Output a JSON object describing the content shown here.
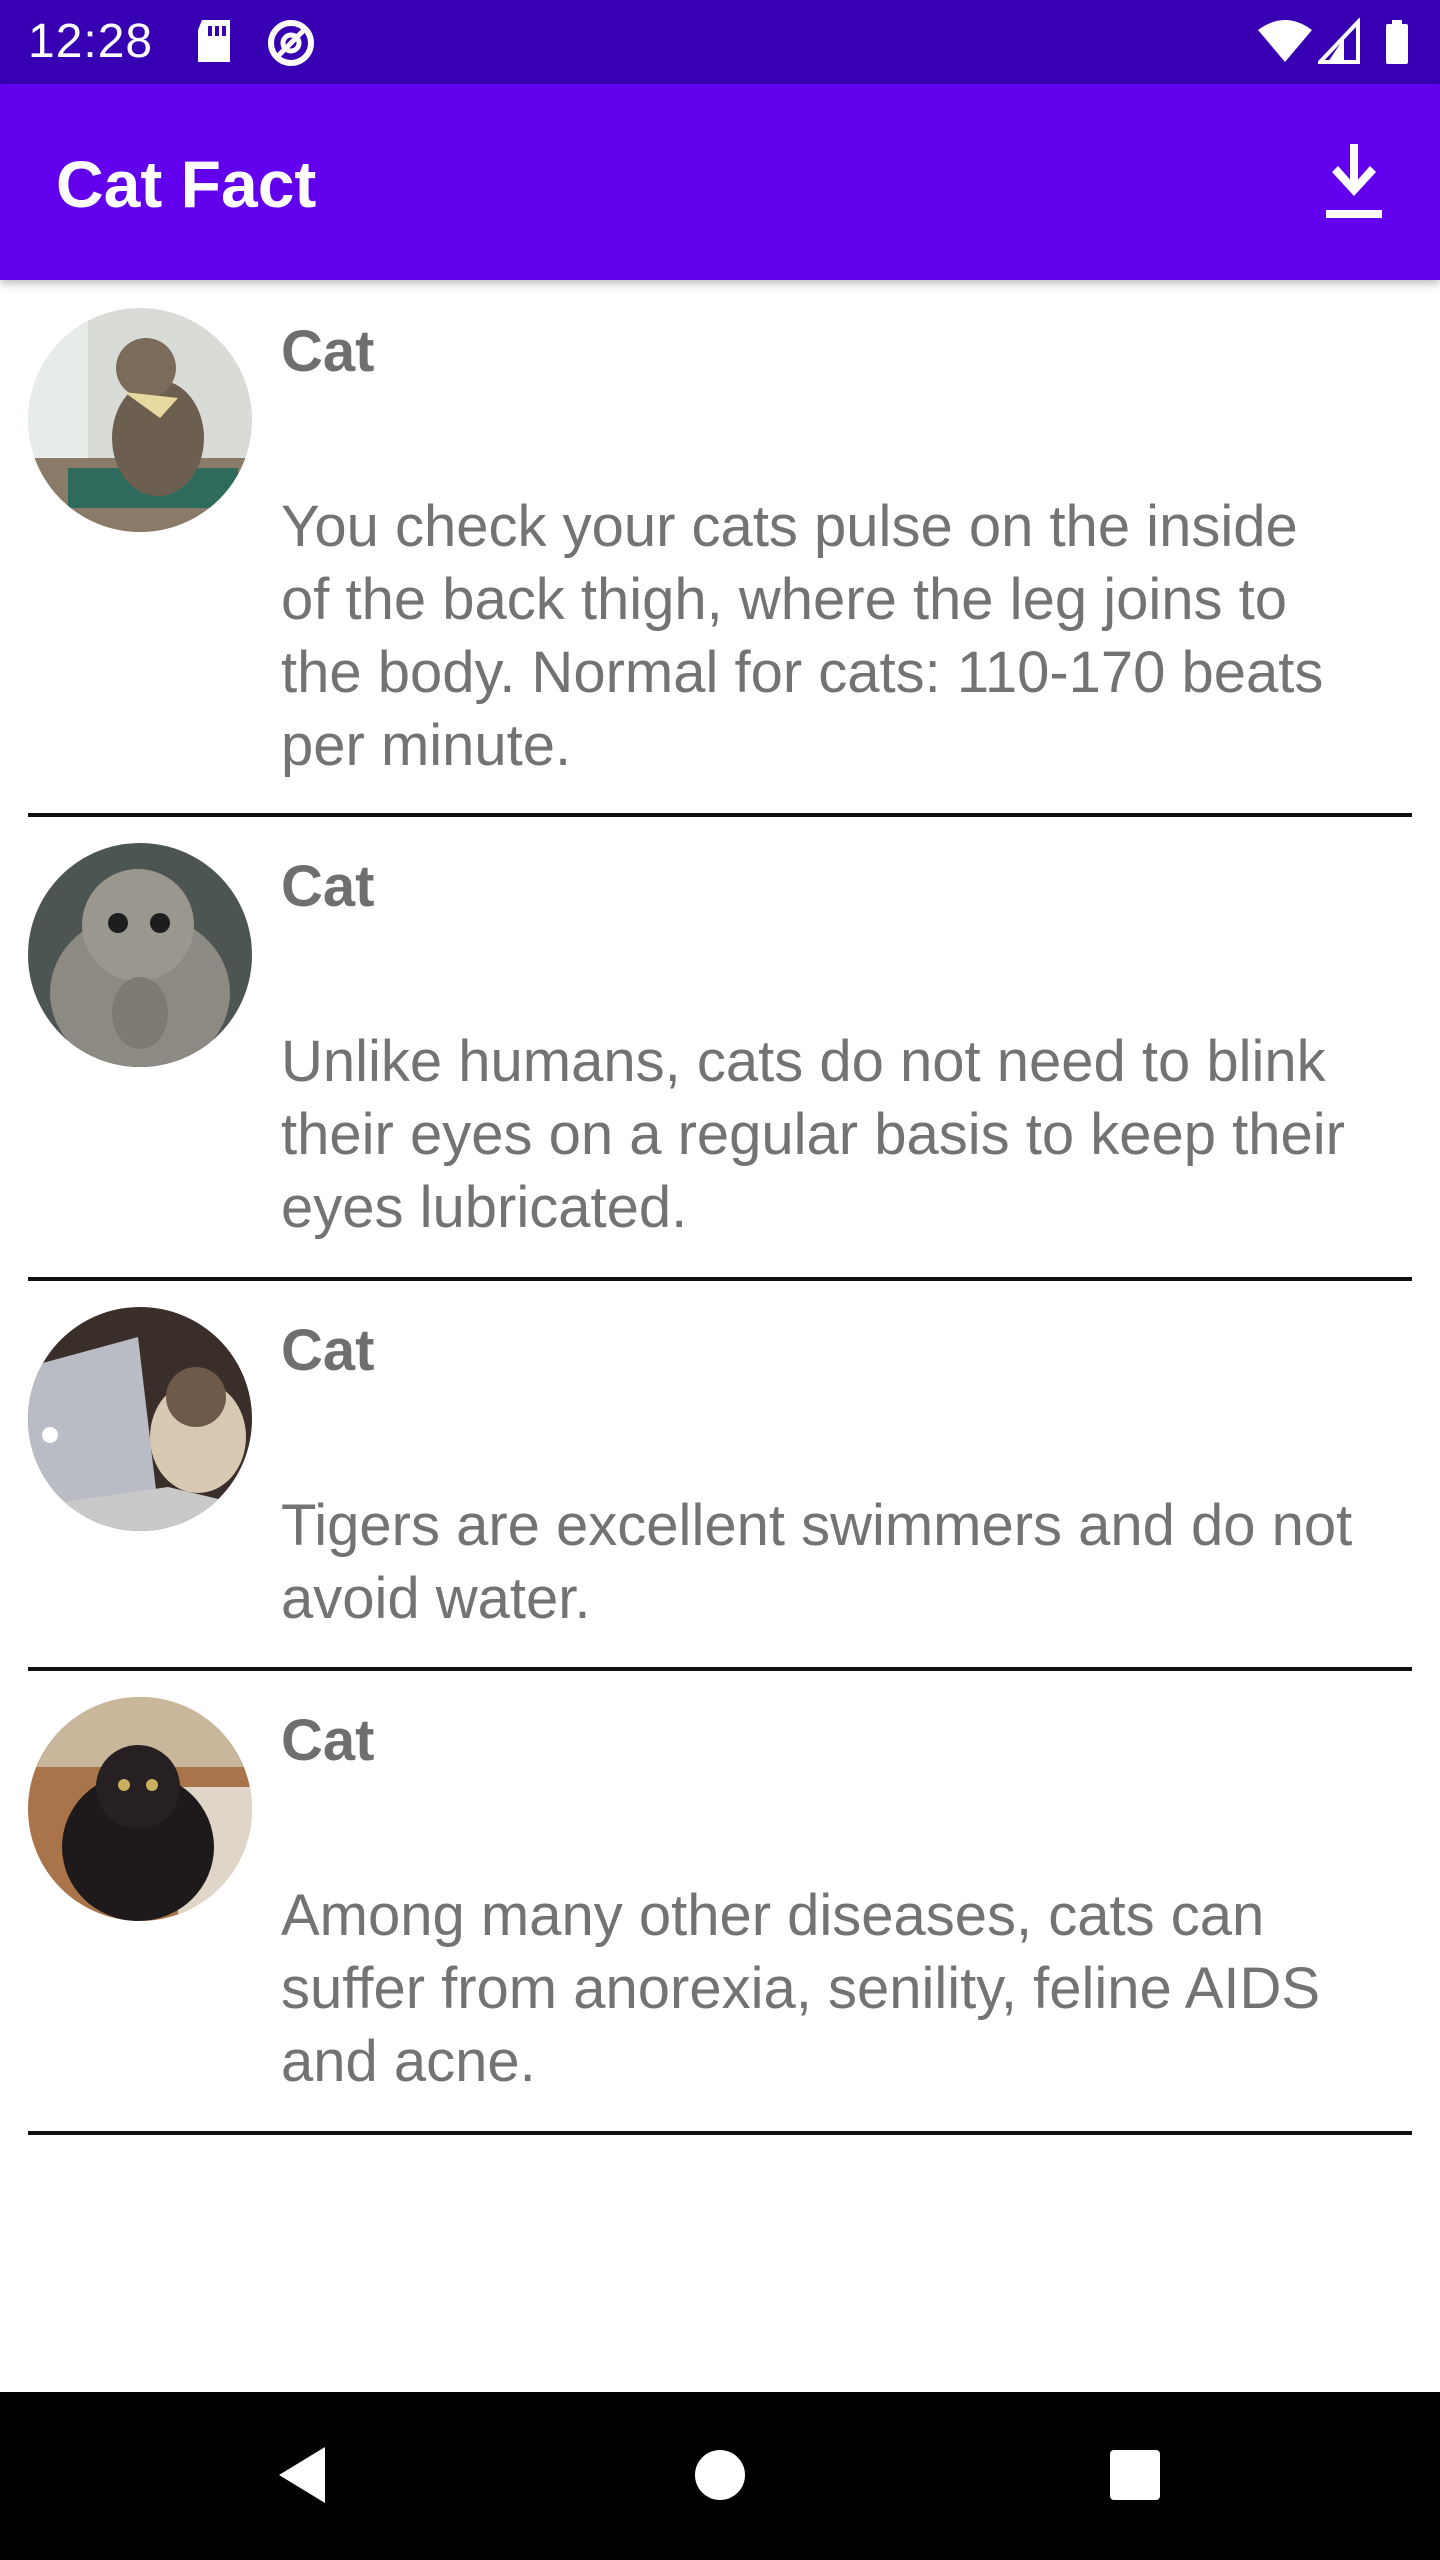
{
  "status_bar": {
    "time": "12:28",
    "icons": [
      "sd-card-icon",
      "at-sign-icon",
      "wifi-icon",
      "cell-signal-icon",
      "battery-icon"
    ]
  },
  "app_bar": {
    "title": "Cat Fact",
    "action_icon": "download-icon"
  },
  "facts": [
    {
      "title": "Cat",
      "text": "You check your cats pulse on the inside of the back thigh, where the leg joins to the body. Normal for cats: 110-170 beats per minute."
    },
    {
      "title": "Cat",
      "text": "Unlike humans, cats do not need to blink their eyes on a regular basis to keep their eyes lubricated."
    },
    {
      "title": "Cat",
      "text": "Tigers are excellent swimmers and do not avoid water."
    },
    {
      "title": "Cat",
      "text": "Among many other diseases, cats can suffer from anorexia, senility, feline AIDS and acne."
    }
  ],
  "nav_bar": {
    "icons": [
      "back-icon",
      "home-icon",
      "recents-icon"
    ]
  },
  "colors": {
    "status_bar": "#3700b3",
    "app_bar": "#6200ee",
    "title_text": "#6f6f6f",
    "body_text": "#737373"
  }
}
